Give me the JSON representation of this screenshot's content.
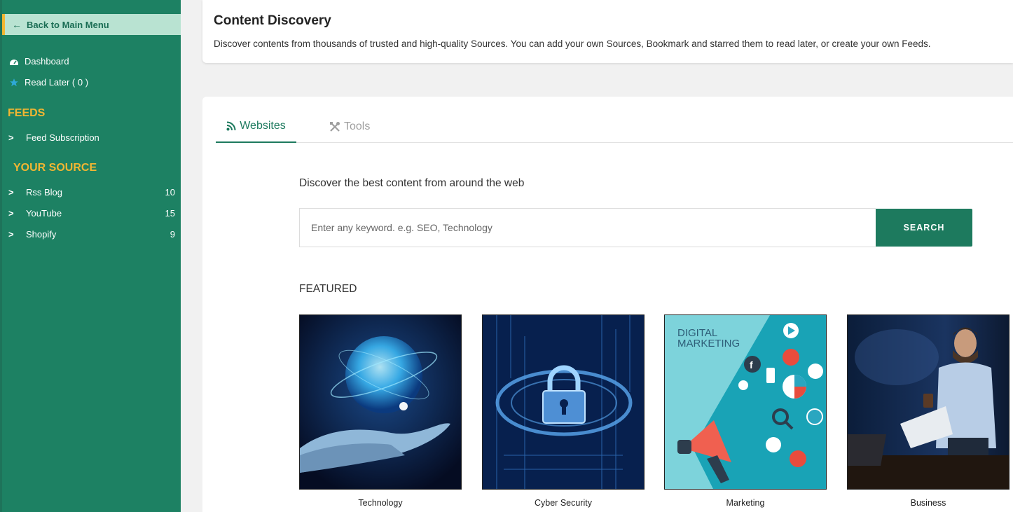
{
  "sidebar": {
    "back_label": "Back to Main Menu",
    "dashboard_label": "Dashboard",
    "read_later_label": "Read Later ( 0 )",
    "feeds_title": "FEEDS",
    "feed_subscription_label": "Feed Subscription",
    "your_source_title": "YOUR SOURCE",
    "sources": [
      {
        "label": "Rss Blog",
        "count": "10"
      },
      {
        "label": "YouTube",
        "count": "15"
      },
      {
        "label": "Shopify",
        "count": "9"
      }
    ]
  },
  "header": {
    "title": "Content Discovery",
    "description": "Discover contents from thousands of trusted and high-quality Sources. You can add your own Sources, Bookmark and starred them to read later, or create your own Feeds."
  },
  "tabs": [
    {
      "label": "Websites",
      "icon": "rss-icon",
      "active": true
    },
    {
      "label": "Tools",
      "icon": "tools-icon",
      "active": false
    }
  ],
  "discover_text": "Discover the best content from around the web",
  "search": {
    "placeholder": "Enter any keyword. e.g. SEO, Technology",
    "button_label": "SEARCH"
  },
  "featured": {
    "title": "FEATURED",
    "items": [
      {
        "label": "Technology"
      },
      {
        "label": "Cyber Security"
      },
      {
        "label": "Marketing",
        "image_text": "DIGITAL MARKETING"
      },
      {
        "label": "Business"
      }
    ]
  },
  "colors": {
    "sidebar_bg": "#1d8163",
    "accent": "#1d7a5e",
    "section_title": "#f2b632",
    "back_bg": "#b9e3d2"
  }
}
